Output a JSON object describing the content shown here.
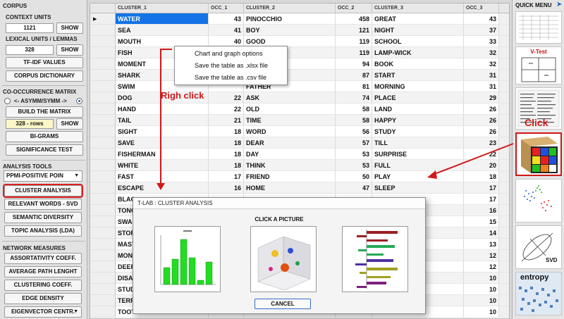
{
  "left_panel": {
    "corpus": {
      "title": "CORPUS",
      "context_units_label": "CONTEXT UNITS",
      "context_units_value": "1121",
      "show": "SHOW",
      "lexical_units_label": "LEXICAL UNITS / LEMMAS",
      "lexical_units_value": "328",
      "tfidf": "TF-IDF VALUES",
      "corpus_dictionary": "CORPUS DICTIONARY"
    },
    "cooccurrence": {
      "title": "CO-OCCURRENCE MATRIX",
      "asym_label": "<- ASYMM/SYMM ->",
      "build_matrix": "BUILD THE MATRIX",
      "rows_value": "328 - rows",
      "show": "SHOW",
      "bigrams": "BI-GRAMS",
      "significance": "SIGNIFICANCE TEST"
    },
    "analysis": {
      "title": "ANALYSIS TOOLS",
      "measure_value": "PPMI-POSITIVE POIN",
      "cluster_analysis": "CLUSTER ANALYSIS",
      "relevant_words": "RELEVANT WORDS - SVD",
      "semantic_diversity": "SEMANTIC DIVERSITY",
      "topic_analysis": "TOPIC ANALYSIS (LDA)"
    },
    "network": {
      "title": "NETWORK MEASURES",
      "assortativity": "ASSORTATIVITY COEFF.",
      "avg_path": "AVERAGE PATH LENGHT",
      "clustering": "CLUSTERING COEFF.",
      "edge_density": "EDGE DENSITY",
      "eigenvector": "EIGENVECTOR CENTR."
    }
  },
  "table": {
    "headers": [
      "CLUSTER_1",
      "OCC_1",
      "CLUSTER_2",
      "OCC_2",
      "CLUSTER_3",
      "OCC_3"
    ],
    "rows": [
      [
        "WATER",
        "43",
        "PINOCCHIO",
        "458",
        "GREAT",
        "43"
      ],
      [
        "SEA",
        "41",
        "BOY",
        "121",
        "NIGHT",
        "37"
      ],
      [
        "MOUTH",
        "40",
        "GOOD",
        "119",
        "SCHOOL",
        "33"
      ],
      [
        "FISH",
        "",
        "",
        "119",
        "LAMP-WICK",
        "32"
      ],
      [
        "MOMENT",
        "",
        "",
        "94",
        "BOOK",
        "32"
      ],
      [
        "SHARK",
        "",
        "",
        "87",
        "START",
        "31"
      ],
      [
        "SWIM",
        "",
        "FATHER",
        "81",
        "MORNING",
        "31"
      ],
      [
        "DOG",
        "22",
        "ASK",
        "74",
        "PLACE",
        "29"
      ],
      [
        "HAND",
        "22",
        "OLD",
        "58",
        "LAND",
        "26"
      ],
      [
        "TAIL",
        "21",
        "TIME",
        "58",
        "HAPPY",
        "26"
      ],
      [
        "SIGHT",
        "18",
        "WORD",
        "56",
        "STUDY",
        "26"
      ],
      [
        "SAVE",
        "18",
        "DEAR",
        "57",
        "TILL",
        "23"
      ],
      [
        "FISHERMAN",
        "18",
        "DAY",
        "53",
        "SURPRISE",
        "22"
      ],
      [
        "WHITE",
        "18",
        "THINK",
        "53",
        "FULL",
        "20"
      ],
      [
        "FAST",
        "17",
        "FRIEND",
        "50",
        "PLAY",
        "18"
      ],
      [
        "ESCAPE",
        "16",
        "HOME",
        "47",
        "SLEEP",
        "17"
      ],
      [
        "BLAC",
        "",
        "",
        "",
        "",
        "17"
      ],
      [
        "TONG",
        "",
        "",
        "",
        "",
        "16"
      ],
      [
        "SWAL",
        "",
        "",
        "",
        "",
        "15"
      ],
      [
        "STOR",
        "",
        "",
        "",
        "",
        "14"
      ],
      [
        "MAST",
        "",
        "",
        "",
        "",
        "13"
      ],
      [
        "MON",
        "",
        "",
        "",
        "",
        "12"
      ],
      [
        "DEEP",
        "",
        "",
        "",
        "",
        "12"
      ],
      [
        "DISA",
        "",
        "",
        "",
        "",
        "10"
      ],
      [
        "STUD",
        "",
        "",
        "",
        "",
        "10"
      ],
      [
        "TERR",
        "",
        "",
        "",
        "",
        "10"
      ],
      [
        "TOOT",
        "",
        "",
        "",
        "",
        "10"
      ]
    ]
  },
  "context_menu": {
    "items": [
      "Chart and graph options",
      "Save the table as .xlsx file",
      "Save the table as .csv file"
    ]
  },
  "dialog": {
    "title": "T-LAB : CLUSTER ANALYSIS",
    "heading": "CLICK A PICTURE",
    "cancel": "CANCEL"
  },
  "quick_menu": {
    "title": "QUICK MENU",
    "vtest_label": "V-Test",
    "svd_label": "SVD",
    "entropy_label": "entropy"
  },
  "annotations": {
    "right_click": "Righ click",
    "click": "Click"
  },
  "colors": {
    "accent_red": "#d01818",
    "selection_blue": "#1473e6",
    "bar_green": "#22dd22"
  }
}
